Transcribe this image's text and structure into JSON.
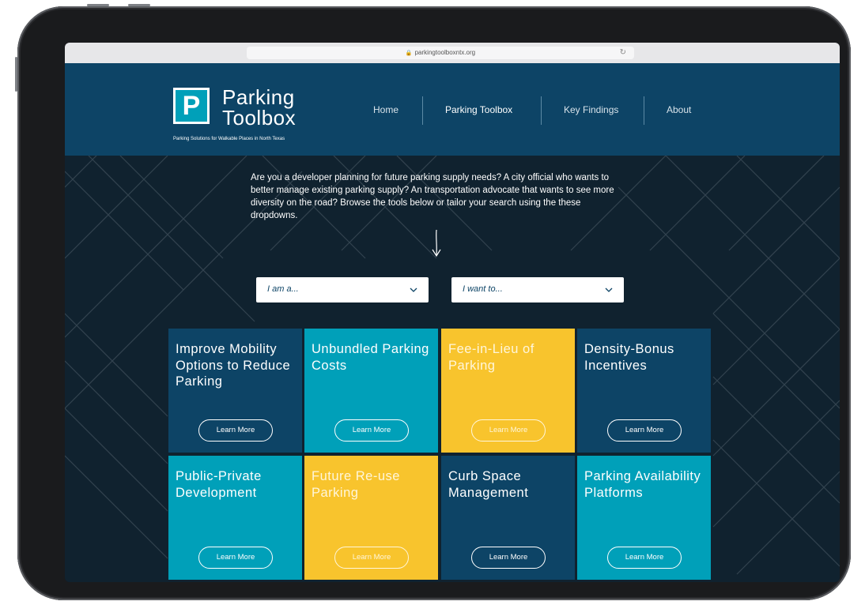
{
  "browser": {
    "url": "parkingtoolboxntx.org"
  },
  "header": {
    "logo_letter": "P",
    "logo_line1": "Parking",
    "logo_line2": "Toolbox",
    "tagline": "Parking Solutions for Walkable Places in North Texas",
    "nav": [
      {
        "label": "Home"
      },
      {
        "label": "Parking Toolbox"
      },
      {
        "label": "Key Findings"
      },
      {
        "label": "About"
      }
    ]
  },
  "hero": {
    "intro": "Are you a developer planning for future parking supply needs? A city official who wants to better manage existing parking supply? An transportation advocate that wants to see more diversity on the road? Browse the tools below or tailor your search using the these dropdowns.",
    "dropdown_role": "I am a...",
    "dropdown_goal": "I want to..."
  },
  "cards": [
    {
      "title": "Improve Mobility Options to Reduce Parking",
      "button": "Learn More",
      "color": "#0d4466"
    },
    {
      "title": "Unbundled Parking Costs",
      "button": "Learn More",
      "color": "#00a0b9"
    },
    {
      "title": "Fee-in-Lieu of Parking",
      "button": "Learn More",
      "color": "#f8c42d"
    },
    {
      "title": "Density-Bonus Incentives",
      "button": "Learn More",
      "color": "#0d4466"
    },
    {
      "title": "Public-Private Development",
      "button": "Learn More",
      "color": "#00a0b9"
    },
    {
      "title": "Future Re-use Parking",
      "button": "Learn More",
      "color": "#f8c42d"
    },
    {
      "title": "Curb Space Management",
      "button": "Learn More",
      "color": "#0d4466"
    },
    {
      "title": "Parking Availability Platforms",
      "button": "Learn More",
      "color": "#00a0b9"
    }
  ],
  "icons": {
    "lock": "lock-icon",
    "reload": "reload-icon",
    "arrow": "arrow-down-icon",
    "chevron": "chevron-down-icon"
  }
}
